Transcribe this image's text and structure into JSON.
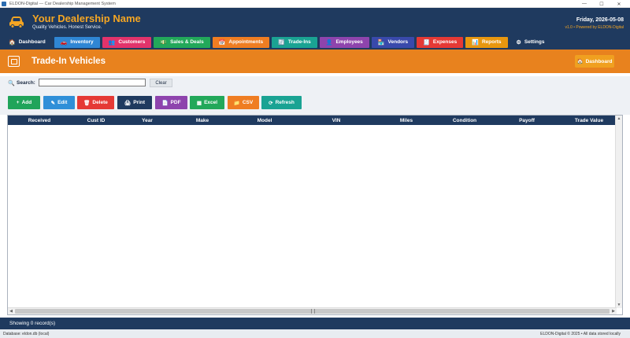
{
  "window": {
    "title": "ELDON-Digital — Car Dealership Management System",
    "min": "—",
    "max": "☐",
    "close": "✕"
  },
  "header": {
    "brand": "Your Dealership Name",
    "tagline": "Quality Vehicles. Honest Service.",
    "date": "Friday, 2026-05-08",
    "version": "v1.0 • Powered by ELDON-Digital"
  },
  "nav": [
    {
      "label": "Dashboard",
      "icon": "🏠",
      "color": "#1f3a5f"
    },
    {
      "label": "Inventory",
      "icon": "🚗",
      "color": "#2f86d4"
    },
    {
      "label": "Customers",
      "icon": "👥",
      "color": "#e2336b"
    },
    {
      "label": "Sales & Deals",
      "icon": "💵",
      "color": "#22a85a"
    },
    {
      "label": "Appointments",
      "icon": "📅",
      "color": "#ef7d22"
    },
    {
      "label": "Trade-Ins",
      "icon": "🔄",
      "color": "#1aa393"
    },
    {
      "label": "Employees",
      "icon": "👤",
      "color": "#8e44ad"
    },
    {
      "label": "Vendors",
      "icon": "🏪",
      "color": "#3949ab"
    },
    {
      "label": "Expenses",
      "icon": "🧾",
      "color": "#e53935"
    },
    {
      "label": "Reports",
      "icon": "📊",
      "color": "#e8970f"
    },
    {
      "label": "Settings",
      "icon": "⚙",
      "color": "#1f3a5f"
    }
  ],
  "page": {
    "title": "Trade-In Vehicles",
    "dashboard_button": "Dashboard"
  },
  "search": {
    "label": "Search:",
    "value": "",
    "placeholder": "",
    "clear": "Clear"
  },
  "actions": [
    {
      "label": "Add",
      "icon": "+",
      "color": "#20a45a"
    },
    {
      "label": "Edit",
      "icon": "✎",
      "color": "#2f8fd8"
    },
    {
      "label": "Delete",
      "icon": "🗑",
      "color": "#e53935"
    },
    {
      "label": "Print",
      "icon": "🖨",
      "color": "#1f3a5f"
    },
    {
      "label": "PDF",
      "icon": "📄",
      "color": "#8e44ad"
    },
    {
      "label": "Excel",
      "icon": "▦",
      "color": "#22a85a"
    },
    {
      "label": "CSV",
      "icon": "📁",
      "color": "#ef7d22"
    },
    {
      "label": "Refresh",
      "icon": "⟳",
      "color": "#1aa393"
    }
  ],
  "table": {
    "columns": [
      "Received",
      "Cust ID",
      "Year",
      "Make",
      "Model",
      "VIN",
      "Miles",
      "Condition",
      "Payoff",
      "Trade Value"
    ],
    "rows": []
  },
  "status": "Showing 0 record(s)",
  "footer": {
    "left": "Database: eldon.db (local)",
    "right": "ELDON-Digital © 2025  •  All data stored locally"
  }
}
